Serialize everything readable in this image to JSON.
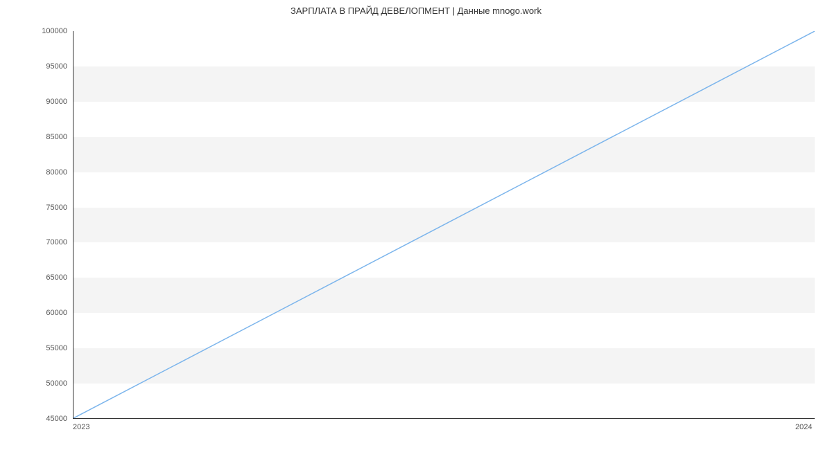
{
  "chart_data": {
    "type": "line",
    "title": "ЗАРПЛАТА В ПРАЙД ДЕВЕЛОПМЕНТ | Данные mnogo.work",
    "x": [
      2023,
      2024
    ],
    "values": [
      45000,
      100000
    ],
    "xlabel": "",
    "ylabel": "",
    "xlim": [
      2023,
      2024
    ],
    "ylim": [
      45000,
      100000
    ],
    "x_ticks": [
      2023,
      2024
    ],
    "y_ticks": [
      45000,
      50000,
      55000,
      60000,
      65000,
      70000,
      75000,
      80000,
      85000,
      90000,
      95000,
      100000
    ],
    "line_color": "#7cb5ec"
  }
}
